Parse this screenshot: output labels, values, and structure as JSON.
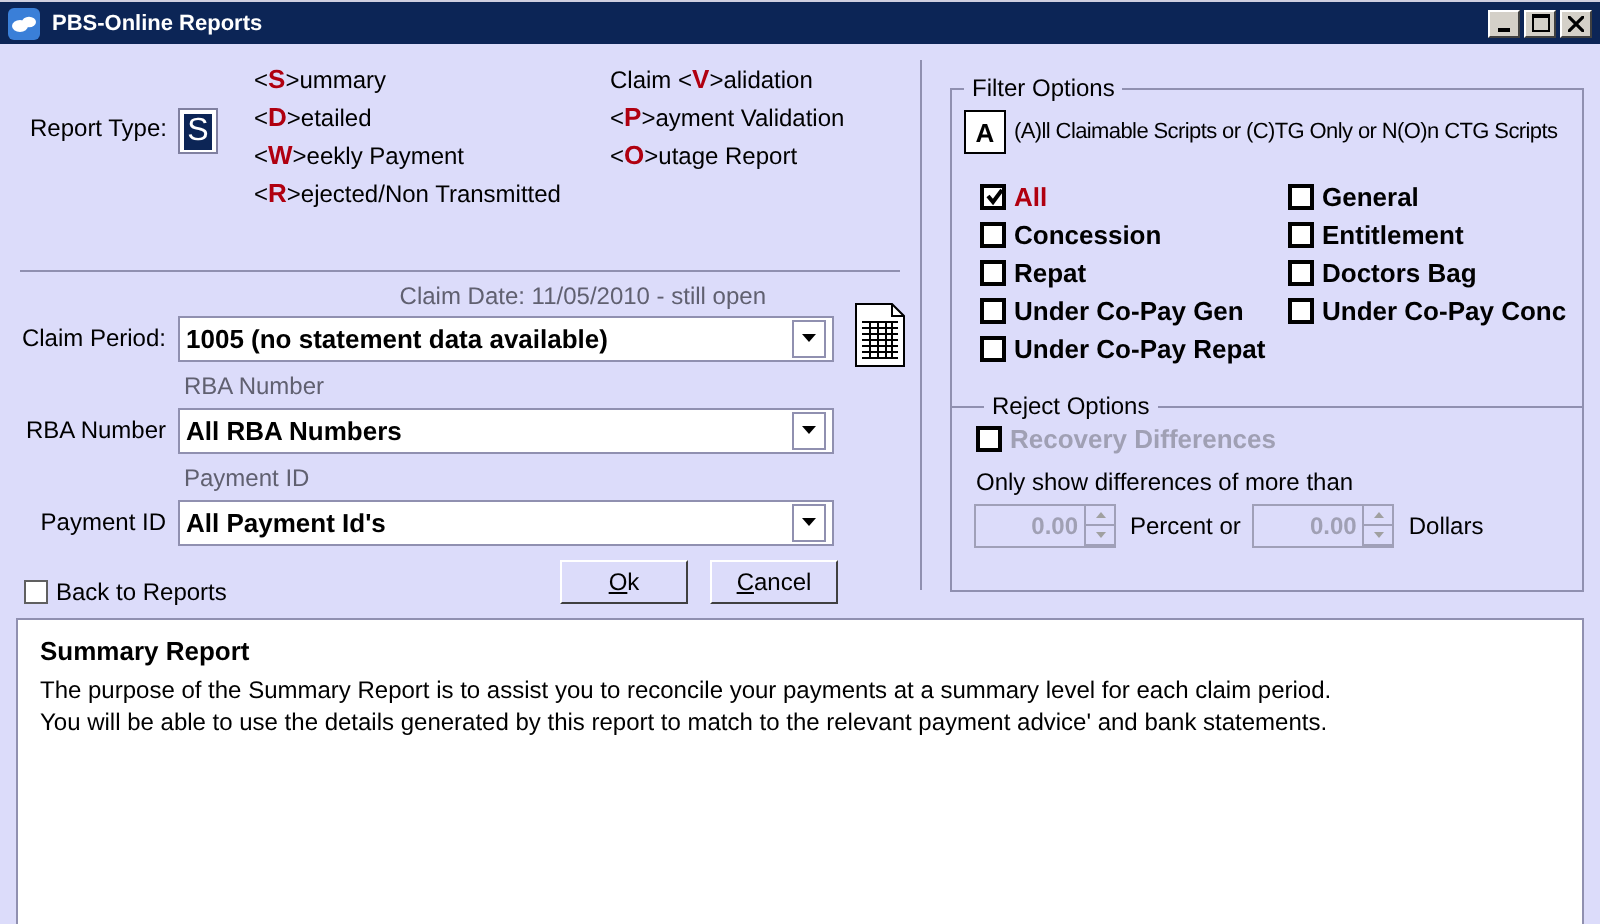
{
  "window": {
    "title": "PBS-Online Reports"
  },
  "report_type": {
    "label": "Report Type:",
    "value": "S",
    "options_column_1": [
      {
        "before": "<",
        "key": "S",
        "after": ">ummary"
      },
      {
        "before": "<",
        "key": "D",
        "after": ">etailed"
      },
      {
        "before": "<",
        "key": "W",
        "after": ">eekly Payment"
      },
      {
        "before": "<",
        "key": "R",
        "after": ">ejected/Non Transmitted"
      }
    ],
    "options_column_2": [
      {
        "before": "Claim <",
        "key": "V",
        "after": ">alidation"
      },
      {
        "before": "<",
        "key": "P",
        "after": ">ayment Validation"
      },
      {
        "before": "<",
        "key": "O",
        "after": ">utage Report"
      }
    ]
  },
  "claim": {
    "date_note": "Claim Date: 11/05/2010 - still open",
    "fields": [
      {
        "label": "Claim Period:",
        "value": "1005 (no statement data available)"
      },
      {
        "caption": "RBA Number",
        "label": "RBA Number",
        "value": "All RBA Numbers"
      },
      {
        "caption": "Payment ID",
        "label": "Payment ID",
        "value": "All Payment Id's"
      }
    ]
  },
  "back_to_reports": {
    "label": "Back to Reports",
    "checked": false
  },
  "buttons": [
    {
      "accel": "O",
      "rest": "k"
    },
    {
      "accel": "C",
      "rest": "ancel"
    }
  ],
  "filter_options": {
    "title": "Filter Options",
    "script_code": "A",
    "script_hint": "(A)ll Claimable Scripts or (C)TG Only or N(O)n CTG Scripts",
    "checkboxes": [
      {
        "label": "All",
        "checked": true
      },
      {
        "label": "Concession",
        "checked": false
      },
      {
        "label": "Repat",
        "checked": false
      },
      {
        "label": "Under Co-Pay Gen",
        "checked": false
      },
      {
        "label": "Under Co-Pay Repat",
        "checked": false
      },
      {
        "label": "General",
        "checked": false
      },
      {
        "label": "Entitlement",
        "checked": false
      },
      {
        "label": "Doctors Bag",
        "checked": false
      },
      {
        "label": "Under Co-Pay Conc",
        "checked": false
      }
    ]
  },
  "reject_options": {
    "title": "Reject Options",
    "recovery": {
      "label": "Recovery Differences",
      "checked": false,
      "disabled": true
    },
    "threshold_label": "Only show differences of more than",
    "inputs": [
      {
        "value": "0.00",
        "unit": "Percent or",
        "disabled": true
      },
      {
        "value": "0.00",
        "unit": "Dollars",
        "disabled": true
      }
    ]
  },
  "description": {
    "title": "Summary Report",
    "lines": [
      "The purpose of the Summary Report is to assist you to reconcile your payments at a summary level for each claim period.",
      "You will be able to use the details generated by this report to match to the relevant payment advice' and bank statements."
    ]
  }
}
